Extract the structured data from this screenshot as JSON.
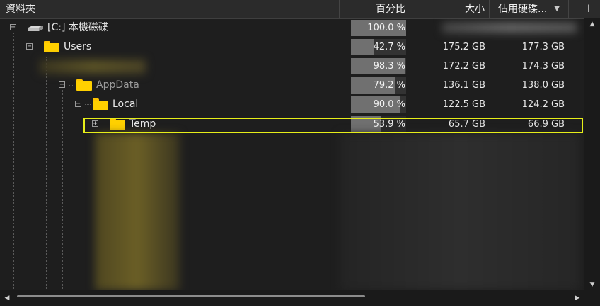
{
  "columns": {
    "folder": "資料夾",
    "percent": "百分比",
    "size": "大小",
    "allocated": "佔用硬碟...",
    "extra": "I"
  },
  "rows": [
    {
      "label": "[C:] 本機磁碟",
      "toggle": "−",
      "percent": "100.0 %",
      "fill": 1.0,
      "size": "",
      "allocated": ""
    },
    {
      "label": "Users",
      "toggle": "−",
      "percent": "42.7 %",
      "fill": 0.427,
      "size": "175.2 GB",
      "allocated": "177.3 GB"
    },
    {
      "label": "",
      "toggle": "",
      "percent": "98.3 %",
      "fill": 0.983,
      "size": "172.2 GB",
      "allocated": "174.3 GB"
    },
    {
      "label": "AppData",
      "toggle": "−",
      "percent": "79.2 %",
      "fill": 0.792,
      "size": "136.1 GB",
      "allocated": "138.0 GB"
    },
    {
      "label": "Local",
      "toggle": "−",
      "percent": "90.0 %",
      "fill": 0.9,
      "size": "122.5 GB",
      "allocated": "124.2 GB"
    },
    {
      "label": "Temp",
      "toggle": "+",
      "percent": "53.9 %",
      "fill": 0.539,
      "size": "65.7 GB",
      "allocated": "66.9 GB"
    }
  ],
  "icons": [
    "drive-icon",
    "folder-icon",
    "sort-descending-icon",
    "scroll-up-arrow",
    "scroll-down-arrow",
    "scroll-left-arrow",
    "scroll-right-arrow"
  ],
  "colors": {
    "highlight": "#e6ee19",
    "folder": "#ffd000",
    "bar": "#707070"
  }
}
